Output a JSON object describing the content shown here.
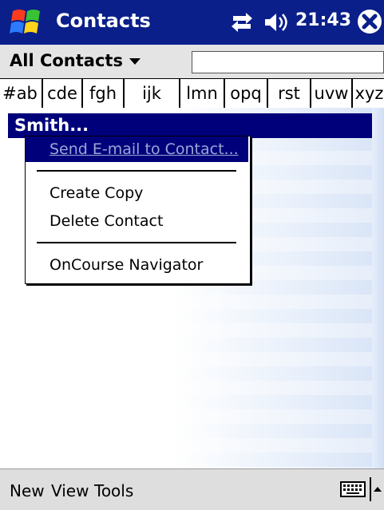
{
  "colors": {
    "titlebar_bg": "#0a1f8a",
    "selection_bg": "#00007b",
    "disabled_text": "#9ba6d6"
  },
  "titlebar": {
    "title": "Contacts",
    "time": "21:43",
    "icons": [
      "windows-start-icon",
      "connectivity-icon",
      "speaker-icon",
      "close-icon"
    ]
  },
  "toolbar": {
    "filter_label": "All Contacts",
    "search_value": ""
  },
  "tabs": [
    "#ab",
    "cde",
    "fgh",
    "ijk",
    "lmn",
    "opq",
    "rst",
    "uvw",
    "xyz"
  ],
  "list": {
    "selected_contact": "Smith..."
  },
  "context_menu": {
    "items": [
      {
        "label": "Send E-mail to Contact...",
        "enabled": false,
        "highlighted": true
      },
      {
        "label": "Create Copy",
        "enabled": true
      },
      {
        "label": "Delete Contact",
        "enabled": true
      },
      {
        "label": "OnCourse Navigator",
        "enabled": true
      }
    ]
  },
  "bottombar": {
    "menus": [
      "New",
      "View",
      "Tools"
    ],
    "icons": [
      "keyboard-icon",
      "input-selector-arrow-icon"
    ]
  }
}
